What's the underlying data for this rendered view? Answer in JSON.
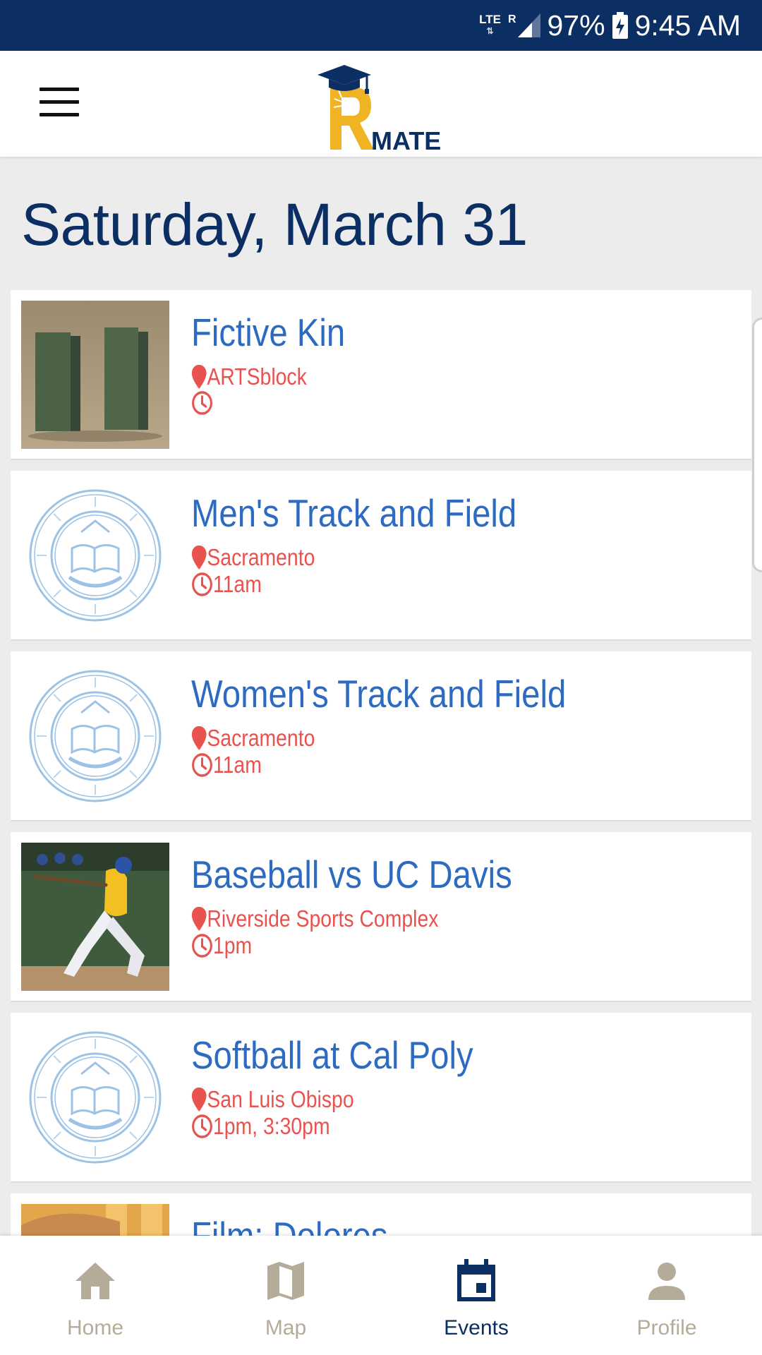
{
  "status_bar": {
    "network": "LTE",
    "roaming": "R",
    "battery": "97%",
    "time": "9:45 AM"
  },
  "app": {
    "logo_text": "MATE",
    "logo_letter": "R"
  },
  "header": {
    "date_title": "Saturday, March 31"
  },
  "events": [
    {
      "title": "Fictive Kin",
      "location": "ARTSblock",
      "time": "",
      "thumb": "artwork-blocks"
    },
    {
      "title": "Men's Track and Field",
      "location": "Sacramento",
      "time": "11am",
      "thumb": "uc-seal"
    },
    {
      "title": "Women's Track and Field",
      "location": "Sacramento",
      "time": "11am",
      "thumb": "uc-seal"
    },
    {
      "title": "Baseball vs UC Davis",
      "location": "Riverside Sports Complex",
      "time": "1pm",
      "thumb": "baseball-photo"
    },
    {
      "title": "Softball at Cal Poly",
      "location": "San Luis Obispo",
      "time": "1pm, 3:30pm",
      "thumb": "uc-seal"
    },
    {
      "title": "Film: Dolores",
      "location": "",
      "time": "",
      "thumb": "film-photo"
    }
  ],
  "bottom_nav": [
    {
      "label": "Home",
      "icon": "home-icon",
      "active": false
    },
    {
      "label": "Map",
      "icon": "map-icon",
      "active": false
    },
    {
      "label": "Events",
      "icon": "calendar-icon",
      "active": true
    },
    {
      "label": "Profile",
      "icon": "person-icon",
      "active": false
    }
  ],
  "colors": {
    "navy": "#0b2e63",
    "title_blue": "#2d6bc2",
    "meta_red": "#e8524f",
    "gold": "#f0b323",
    "nav_inactive": "#b5ab99"
  }
}
